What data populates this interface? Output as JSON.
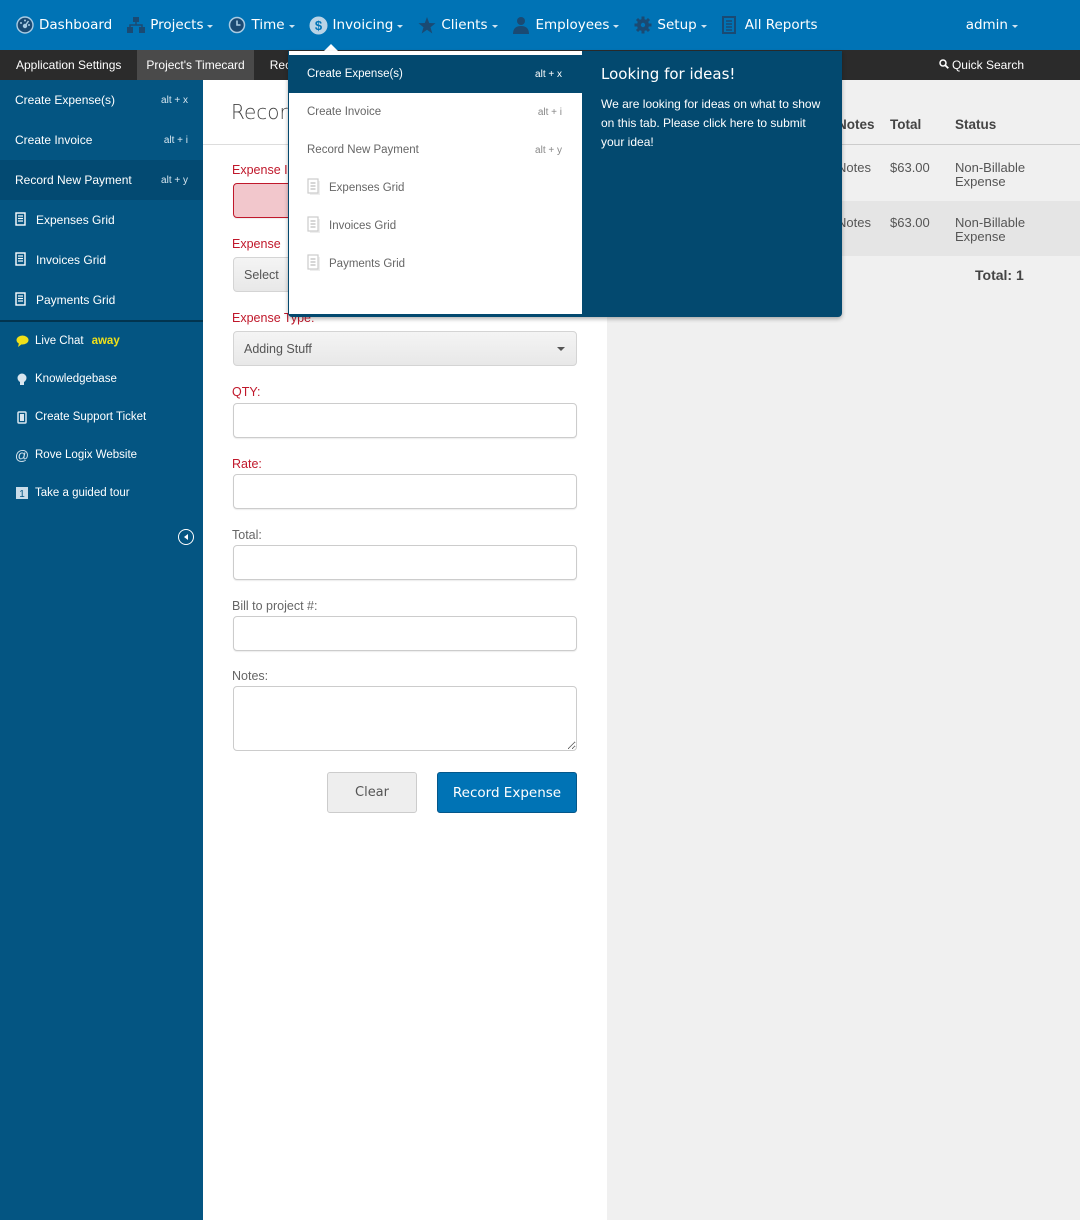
{
  "topnav": {
    "items": [
      {
        "label": "Dashboard",
        "icon": "dashboard-icon",
        "has_caret": false
      },
      {
        "label": "Projects",
        "icon": "sitemap-icon",
        "has_caret": true
      },
      {
        "label": "Time",
        "icon": "clock-icon",
        "has_caret": true
      },
      {
        "label": "Invoicing",
        "icon": "dollar-icon",
        "has_caret": true
      },
      {
        "label": "Clients",
        "icon": "star-icon",
        "has_caret": true
      },
      {
        "label": "Employees",
        "icon": "user-icon",
        "has_caret": true
      },
      {
        "label": "Setup",
        "icon": "gear-icon",
        "has_caret": true
      },
      {
        "label": "All Reports",
        "icon": "document-icon",
        "has_caret": false
      }
    ],
    "user": "admin"
  },
  "subbar": {
    "tabs": [
      {
        "label": "Application Settings",
        "active": false
      },
      {
        "label": "Project's Timecard",
        "active": true
      },
      {
        "label": "Rec",
        "active": false
      }
    ],
    "quick_search": "Quick Search"
  },
  "sidebar": {
    "items": [
      {
        "label": "Create Expense(s)",
        "shortcut": "alt + x"
      },
      {
        "label": "Create Invoice",
        "shortcut": "alt + i"
      },
      {
        "label": "Record New Payment",
        "shortcut": "alt + y"
      },
      {
        "label": "Expenses Grid"
      },
      {
        "label": "Invoices Grid"
      },
      {
        "label": "Payments Grid"
      }
    ],
    "help": [
      {
        "label": "Live Chat",
        "status": "away"
      },
      {
        "label": "Knowledgebase"
      },
      {
        "label": "Create Support Ticket"
      },
      {
        "label": "Rove Logix Website"
      },
      {
        "label": "Take a guided tour"
      }
    ]
  },
  "form": {
    "title": "Record",
    "fields": {
      "expense_date_label": "Expense I",
      "expense_category_label": "Expense",
      "expense_category_value": "Select",
      "expense_type_label": "Expense Type:",
      "expense_type_value": "Adding Stuff",
      "qty_label": "QTY:",
      "rate_label": "Rate:",
      "total_label": "Total:",
      "bill_to_label": "Bill to project #:",
      "notes_label": "Notes:"
    },
    "values": {
      "expense_date": "",
      "qty": "",
      "rate": "",
      "total": "",
      "bill_to": "",
      "notes": ""
    },
    "clear_label": "Clear",
    "submit_label": "Record Expense"
  },
  "table": {
    "headers": {
      "notes": "Notes",
      "total": "Total",
      "status": "Status"
    },
    "rows": [
      {
        "notes": "Notes",
        "total": "$63.00",
        "status": "Non-Billable Expense"
      },
      {
        "notes": "Notes",
        "total": "$63.00",
        "status": "Non-Billable Expense"
      }
    ],
    "total_count": "Total: 1"
  },
  "dropdown": {
    "items": [
      {
        "label": "Create Expense(s)",
        "shortcut": "alt + x",
        "active": true
      },
      {
        "label": "Create Invoice",
        "shortcut": "alt + i"
      },
      {
        "label": "Record New Payment",
        "shortcut": "alt + y"
      },
      {
        "label": "Expenses Grid"
      },
      {
        "label": "Invoices Grid"
      },
      {
        "label": "Payments Grid"
      }
    ],
    "ideas_title": "Looking for ideas!",
    "ideas_text": "We are looking for ideas on what to show on this tab. Please click here to submit your idea!"
  },
  "colors": {
    "brand_blue": "#0073b5",
    "sidebar_blue": "#045582",
    "error_red": "#c0182b",
    "away_yellow": "#f0e01a"
  }
}
